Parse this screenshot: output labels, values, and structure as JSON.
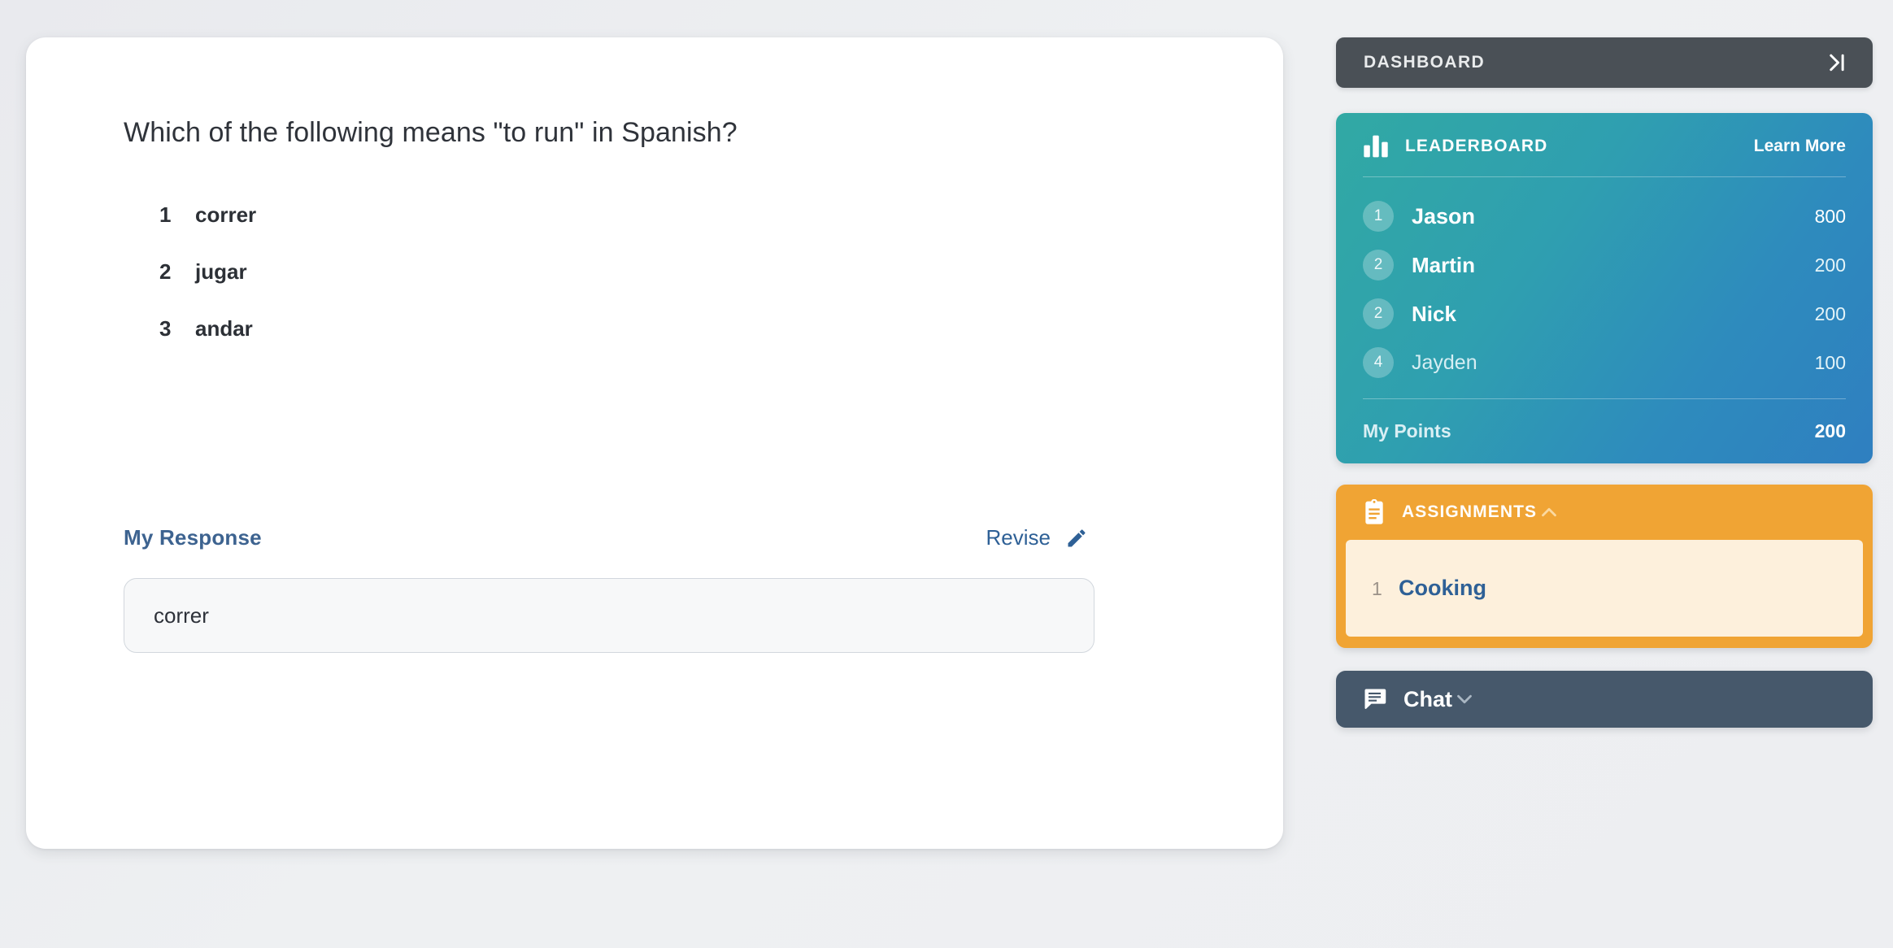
{
  "question_card": {
    "question": "Which of the following means \"to run\" in Spanish?",
    "options": [
      {
        "number": "1",
        "label": "correr"
      },
      {
        "number": "2",
        "label": "jugar"
      },
      {
        "number": "3",
        "label": "andar"
      }
    ],
    "response_label": "My Response",
    "revise_label": "Revise",
    "revise_icon": "pencil-icon",
    "response_value": "correr",
    "response_placeholder": ""
  },
  "sidebar": {
    "dashboard": {
      "title": "DASHBOARD",
      "collapse_icon": "collapse-right-icon"
    },
    "leaderboard": {
      "icon": "bar-chart-icon",
      "title": "LEADERBOARD",
      "learn_more": "Learn More",
      "rows": [
        {
          "rank": "1",
          "name": "Jason",
          "score": "800"
        },
        {
          "rank": "2",
          "name": "Martin",
          "score": "200"
        },
        {
          "rank": "2",
          "name": "Nick",
          "score": "200"
        },
        {
          "rank": "4",
          "name": "Jayden",
          "score": "100"
        }
      ],
      "my_points_label": "My Points",
      "my_points_value": "200",
      "gradient_start": "#31a9a4",
      "gradient_end": "#2f7fc0"
    },
    "assignments": {
      "icon": "clipboard-icon",
      "title": "ASSIGNMENTS",
      "toggle_icon": "chevron-up-icon",
      "accent": "#f0a434",
      "items": [
        {
          "number": "1",
          "label": "Cooking"
        }
      ]
    },
    "chat": {
      "icon": "chat-bubble-icon",
      "title": "Chat",
      "toggle_icon": "chevron-down-icon",
      "accent": "#46586b"
    }
  }
}
